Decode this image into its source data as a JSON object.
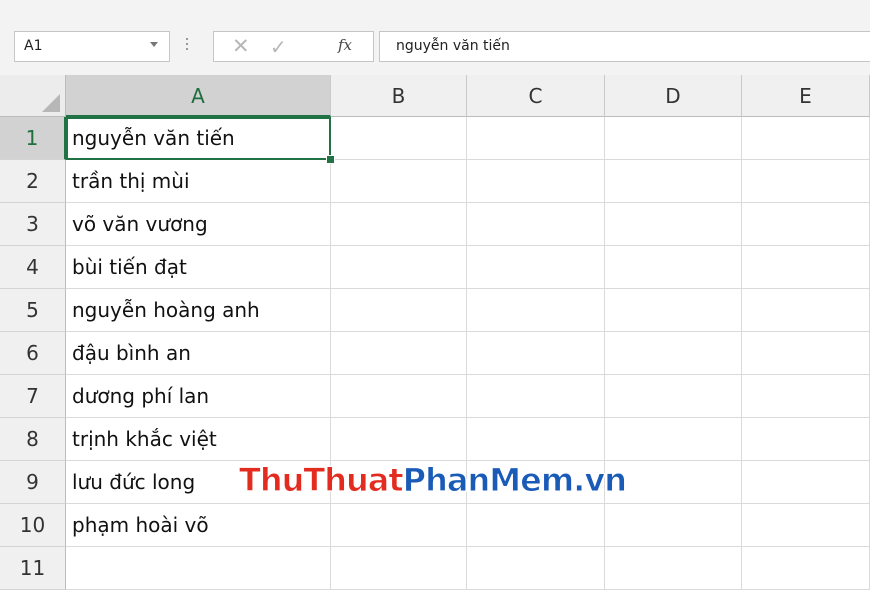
{
  "name_box": {
    "value": "A1"
  },
  "formula_bar": {
    "cancel_glyph": "✕",
    "enter_glyph": "✓",
    "fx_label": "fx",
    "value": "nguyễn văn tiến"
  },
  "columns": [
    "A",
    "B",
    "C",
    "D",
    "E"
  ],
  "selected_column": "A",
  "rows": [
    {
      "num": "1",
      "a": "nguyễn văn tiến"
    },
    {
      "num": "2",
      "a": "trần thị mùi"
    },
    {
      "num": "3",
      "a": "võ văn vương"
    },
    {
      "num": "4",
      "a": "bùi tiến đạt"
    },
    {
      "num": "5",
      "a": "nguyễn hoàng anh"
    },
    {
      "num": "6",
      "a": "đậu bình an"
    },
    {
      "num": "7",
      "a": "dương phí lan"
    },
    {
      "num": "8",
      "a": "trịnh khắc việt"
    },
    {
      "num": "9",
      "a": "lưu đức long"
    },
    {
      "num": "10",
      "a": "phạm hoài võ"
    },
    {
      "num": "11",
      "a": ""
    }
  ],
  "watermark": {
    "part1": "ThuThuat",
    "part2": "PhanMem.vn"
  },
  "colors": {
    "accent": "#217346",
    "watermark_red": "#e32b1f",
    "watermark_blue": "#1a5bb8"
  }
}
